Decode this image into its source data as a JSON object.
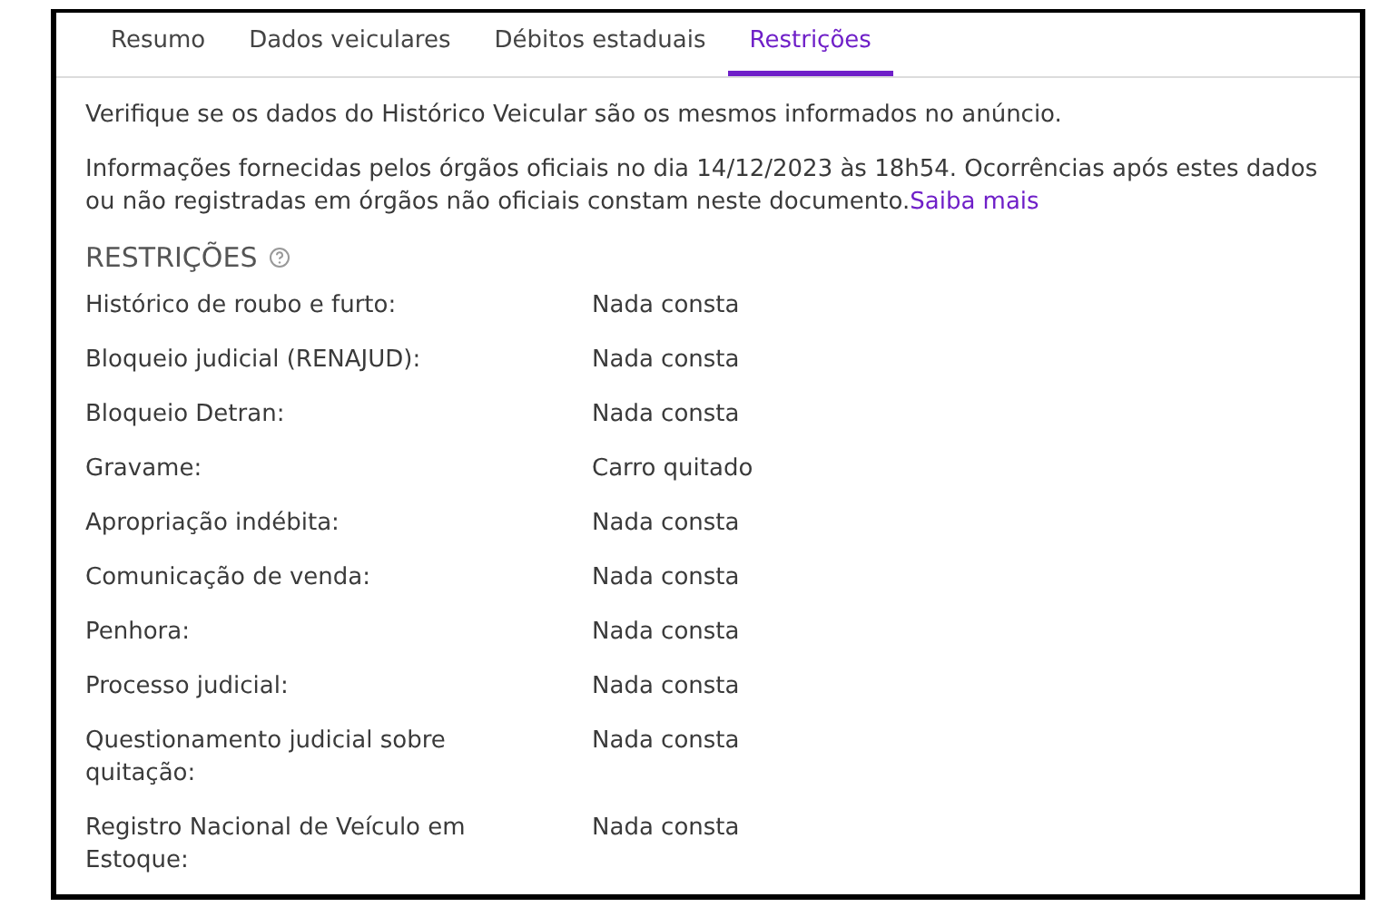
{
  "tabs": [
    {
      "label": "Resumo",
      "selected": false
    },
    {
      "label": "Dados veiculares",
      "selected": false
    },
    {
      "label": "Débitos estaduais",
      "selected": false
    },
    {
      "label": "Restrições",
      "selected": true
    }
  ],
  "intro": "Verifique se os dados do Histórico Veicular são os mesmos informados no anúncio.",
  "notice": {
    "text": "Informações fornecidas pelos órgãos oficiais no dia 14/12/2023 às 18h54. Ocorrências após estes dados ou não registradas em órgãos não oficiais constam neste documento.",
    "link": "Saiba mais"
  },
  "section_title": "RESTRIÇÕES",
  "rows": [
    {
      "label": "Histórico de roubo e furto:",
      "value": "Nada consta"
    },
    {
      "label": "Bloqueio judicial (RENAJUD):",
      "value": "Nada consta"
    },
    {
      "label": "Bloqueio Detran:",
      "value": "Nada consta"
    },
    {
      "label": "Gravame:",
      "value": "Carro quitado"
    },
    {
      "label": "Apropriação indébita:",
      "value": "Nada consta"
    },
    {
      "label": "Comunicação de venda:",
      "value": "Nada consta"
    },
    {
      "label": "Penhora:",
      "value": "Nada consta"
    },
    {
      "label": "Processo judicial:",
      "value": "Nada consta"
    },
    {
      "label": "Questionamento judicial sobre quitação:",
      "value": "Nada consta"
    },
    {
      "label": "Registro Nacional de Veículo em Estoque:",
      "value": "Nada consta"
    }
  ]
}
